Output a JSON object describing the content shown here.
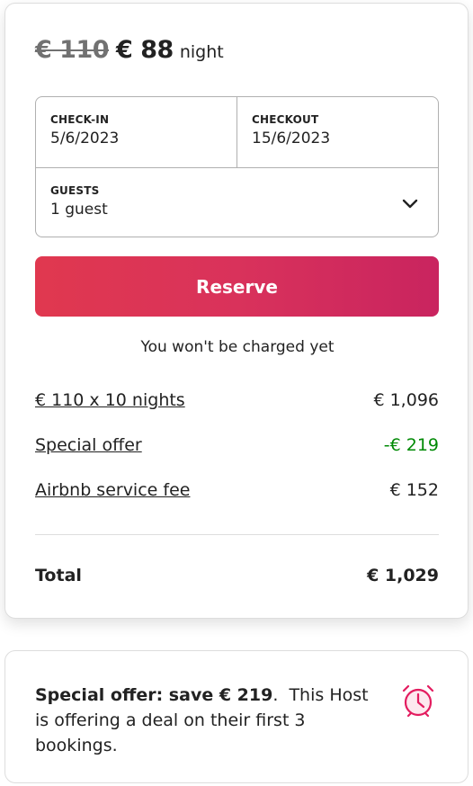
{
  "price": {
    "original": "€ 110",
    "discounted": "€ 88",
    "unit": "night"
  },
  "dates": {
    "checkin_label": "CHECK-IN",
    "checkin_value": "5/6/2023",
    "checkout_label": "CHECKOUT",
    "checkout_value": "15/6/2023"
  },
  "guests": {
    "label": "GUESTS",
    "value": "1 guest"
  },
  "reserve": {
    "label": "Reserve",
    "notice": "You won't be charged yet"
  },
  "breakdown": [
    {
      "label": "€ 110 x 10 nights",
      "amount": "€ 1,096"
    },
    {
      "label": "Special offer",
      "amount": "-€ 219"
    },
    {
      "label": "Airbnb service fee",
      "amount": "€ 152"
    }
  ],
  "total": {
    "label": "Total",
    "amount": "€ 1,029"
  },
  "special_offer": {
    "title": "Special offer: save € 219",
    "body": "This Host is offering a deal on their first 3 bookings.",
    "icon": "alarm-clock-icon"
  },
  "colors": {
    "brand_gradient_start": "#e0384f",
    "brand_gradient_end": "#c9245f",
    "discount_green": "#008a05",
    "icon_pink": "#e31c5f"
  }
}
